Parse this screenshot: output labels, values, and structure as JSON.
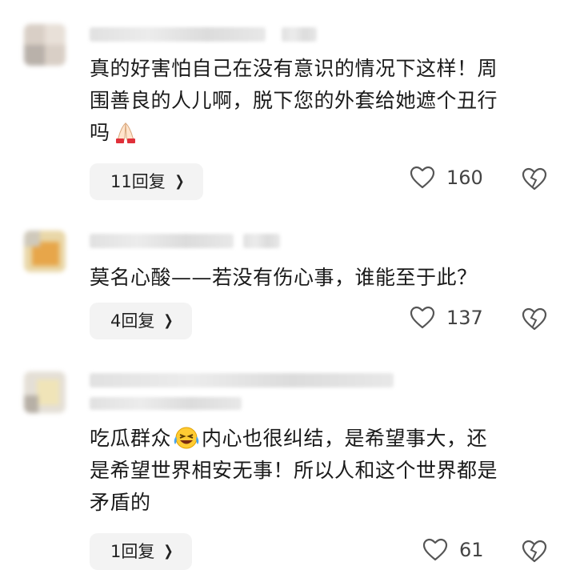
{
  "comments": [
    {
      "text_lines": [
        "真的好害怕自己在没有意识的情况下这样！周",
        "围善良的人儿啊，脱下您的外套给她遮个丑行",
        "吗"
      ],
      "emoji_after_last_line": "folded-hands-emoji",
      "reply_label": "11回复",
      "like_count": "160"
    },
    {
      "text_lines": [
        "莫名心酸——若没有伤心事，谁能至于此？"
      ],
      "reply_label": "4回复",
      "like_count": "137"
    },
    {
      "text_prefix": "吃瓜群众",
      "inline_emoji": "laughing-crying-emoji",
      "text_line1_suffix": "内心也很纠结，是希望事大，还",
      "text_lines_rest": [
        "是希望世界相安无事！所以人和这个世界都是",
        "矛盾的"
      ],
      "reply_label": "1回复",
      "like_count": "61"
    }
  ],
  "icons": {
    "like": "heart-outline-icon",
    "dislike": "broken-heart-icon",
    "reply_chevron": "chevron-right-icon"
  }
}
